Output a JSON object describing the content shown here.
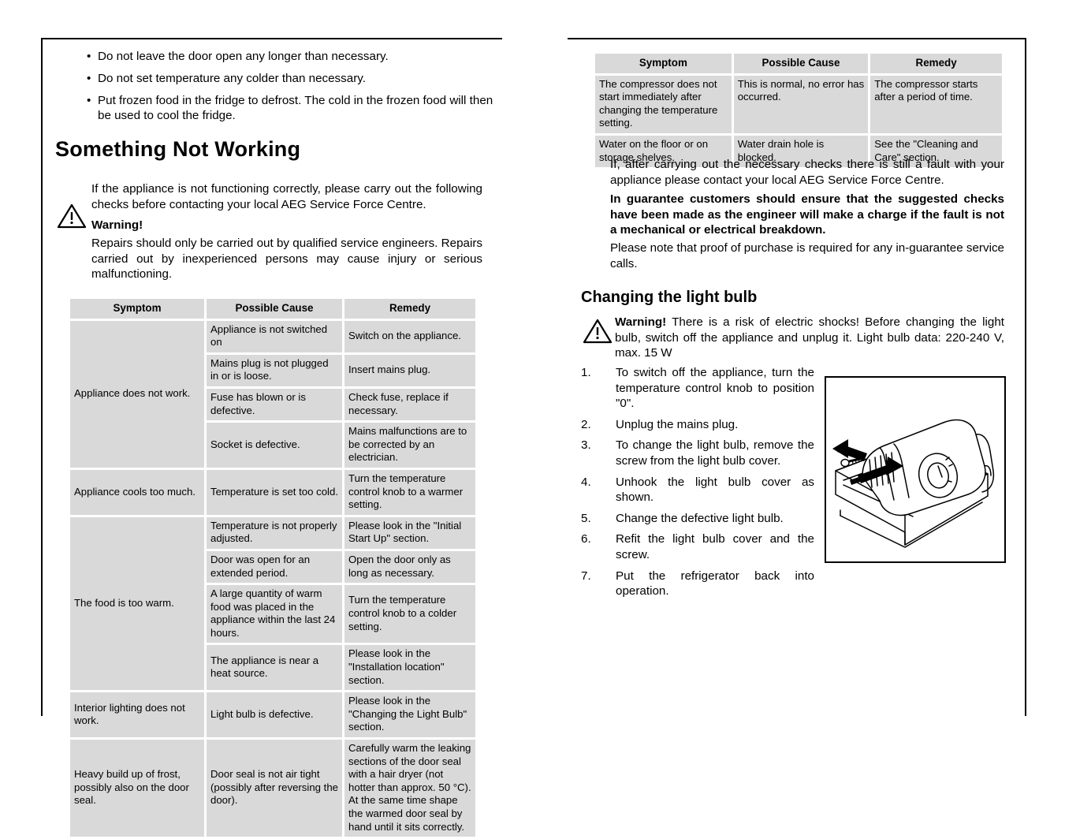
{
  "left_page": {
    "bullets": [
      "Do not leave the door open any longer than necessary.",
      "Do not set temperature any colder than necessary.",
      "Put frozen food in the fridge to defrost. The cold in the frozen food will then be used to cool the fridge."
    ],
    "section_title": "Something Not Working",
    "intro": "If the appliance is not functioning correctly, please carry out the following checks before contacting your local AEG Service Force Centre.",
    "warning_label": "Warning!",
    "warning_body": "Repairs should only be carried out by qualified service engineers. Repairs carried out by inexperienced persons may cause injury or serious malfunctioning.",
    "table": {
      "headers": [
        "Symptom",
        "Possible Cause",
        "Remedy"
      ],
      "rows": [
        {
          "symptom": "Appliance does not work.",
          "symptom_rowspan": 4,
          "cause": "Appliance is not switched on",
          "remedy": "Switch on the appliance."
        },
        {
          "cause": "Mains plug is not plugged in or is loose.",
          "remedy": "Insert mains plug."
        },
        {
          "cause": "Fuse has blown or is defective.",
          "remedy": "Check fuse, replace if necessary."
        },
        {
          "cause": "Socket is defective.",
          "remedy": "Mains malfunctions are to be corrected by an electrician."
        },
        {
          "symptom": "Appliance cools too much.",
          "symptom_rowspan": 1,
          "cause": "Temperature is set too cold.",
          "remedy": "Turn the temperature control knob to a warmer setting."
        },
        {
          "symptom": "The food is too warm.",
          "symptom_rowspan": 4,
          "cause": "Temperature is not properly adjusted.",
          "remedy": "Please look in the \"Initial Start Up\" section."
        },
        {
          "cause": "Door was open for an extended period.",
          "remedy": "Open the door only as long as necessary."
        },
        {
          "cause": "A large quantity of warm food was placed in the appliance within the last 24 hours.",
          "remedy": "Turn the temperature control knob to a colder setting."
        },
        {
          "cause": "The appliance is near a heat source.",
          "remedy": "Please look in the \"Installation location\" section."
        },
        {
          "symptom": "Interior lighting does not work.",
          "symptom_rowspan": 1,
          "cause": "Light bulb is defective.",
          "remedy": "Please look in the \"Changing the Light Bulb\" section."
        },
        {
          "symptom": "Heavy build up of frost, possibly also on the door seal.",
          "symptom_rowspan": 1,
          "cause": "Door seal is not air tight (possibly after reversing the door).",
          "remedy": "Carefully warm the leaking sections of the door seal with a hair dryer (not hotter than approx. 50 °C). At the same time shape the warmed door seal by hand until it sits correctly."
        }
      ]
    }
  },
  "right_page": {
    "table": {
      "headers": [
        "Symptom",
        "Possible Cause",
        "Remedy"
      ],
      "rows": [
        {
          "symptom": "The compressor does not start immediately after changing the temperature setting.",
          "cause": "This is normal, no error has occurred.",
          "remedy": "The compressor starts after a period of time."
        },
        {
          "symptom": "Water on the floor or on storage shelves.",
          "cause": "Water drain hole is blocked.",
          "remedy": "See the \"Cleaning and Care\" section."
        }
      ]
    },
    "paragraph_1": "If, after carrying out the necessary checks there is still a fault with your appliance please contact your local AEG Service Force Centre.",
    "paragraph_2": "In guarantee customers should ensure that the suggested checks have been made as the engineer will make a charge if the fault is not a mechanical or electrical breakdown.",
    "paragraph_3": "Please note that proof of purchase is required for any in-guarantee service calls.",
    "sub_title": "Changing the light bulb",
    "warning_label": "Warning!",
    "warning_body": " There is a risk of electric shocks! Before changing the light bulb, switch off the appliance and unplug it. Light bulb data: 220-240 V, max. 15 W",
    "steps": [
      {
        "num": "1.",
        "text": "To switch off the appliance, turn the temperature control knob to position \"0\"."
      },
      {
        "num": "2.",
        "text": "Unplug the mains plug."
      },
      {
        "num": "3.",
        "text": "To change the light bulb, remove the screw from the light bulb cover."
      },
      {
        "num": "4.",
        "text": "Unhook the light bulb cover as shown."
      },
      {
        "num": "5.",
        "text": "Change the defective light bulb."
      },
      {
        "num": "6.",
        "text": "Refit the light bulb cover and the screw."
      },
      {
        "num": "7.",
        "text": "Put the refrigerator back into operation."
      }
    ],
    "figure_caption": ""
  },
  "colors": {
    "cell_background": "#d9d9d9",
    "text": "#000000",
    "page_background": "#ffffff"
  }
}
